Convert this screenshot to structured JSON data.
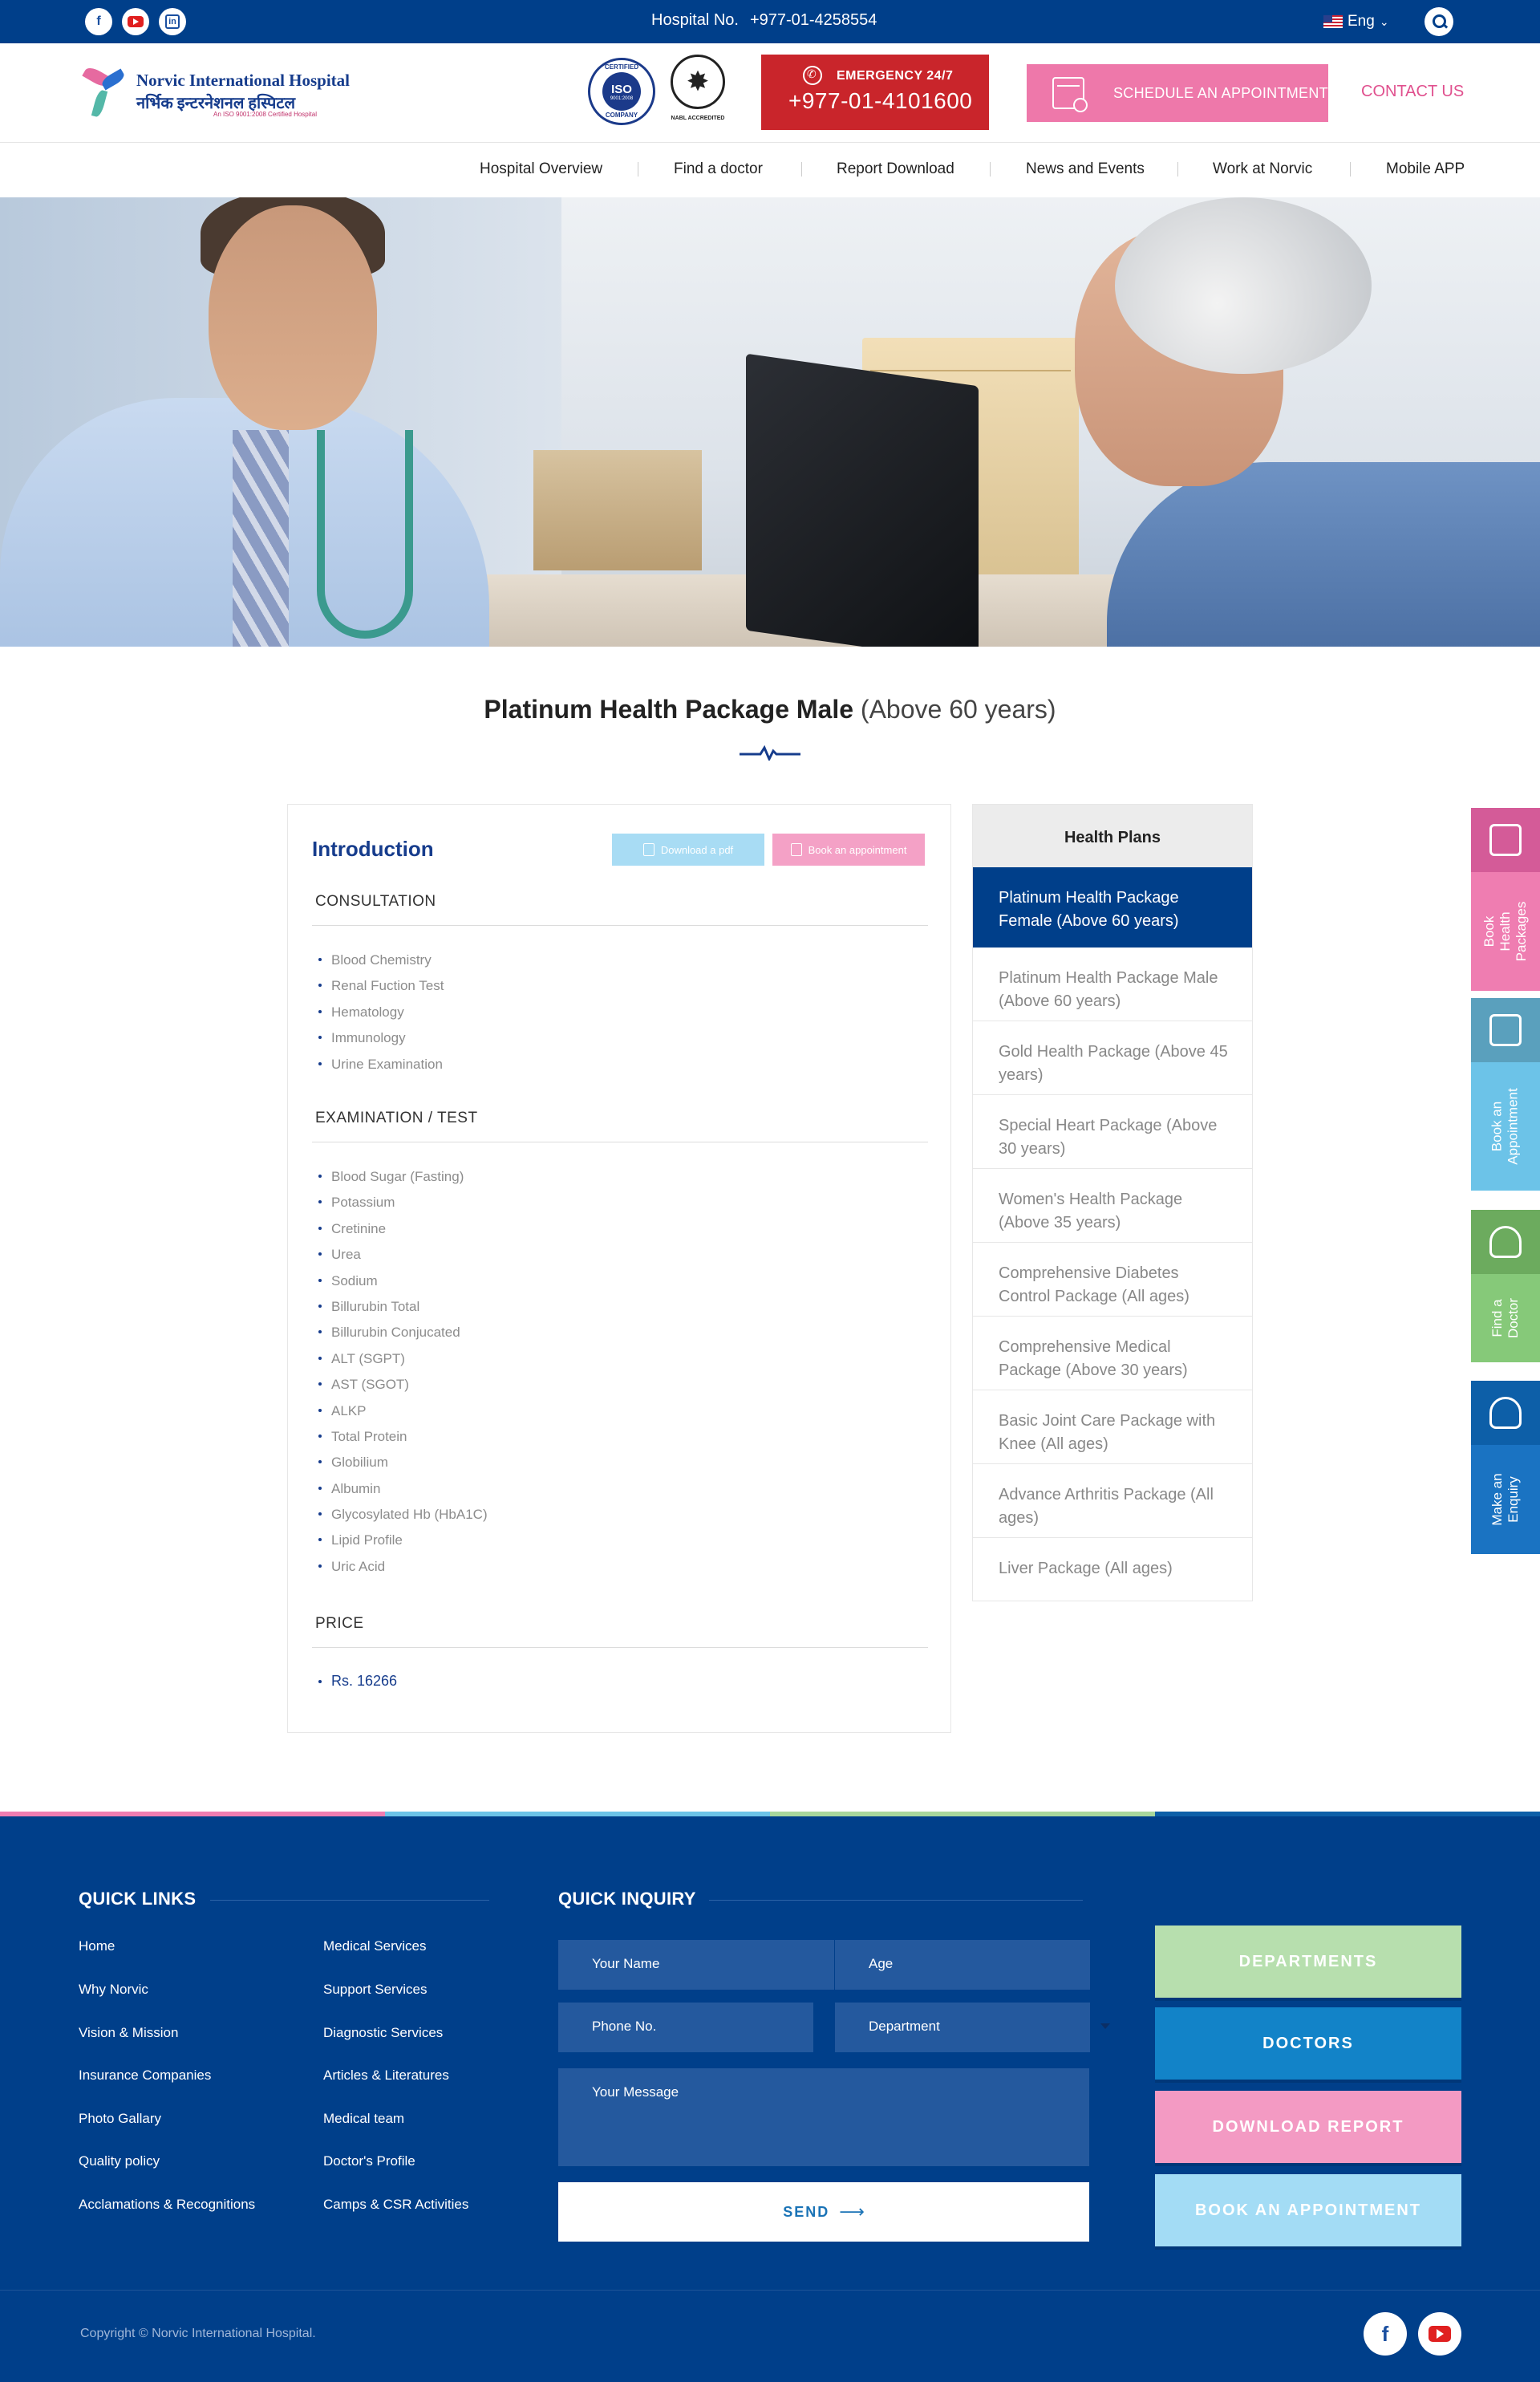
{
  "topbar": {
    "social": [
      {
        "name": "facebook-icon",
        "glyph": "f"
      },
      {
        "name": "youtube-icon",
        "glyph": ""
      },
      {
        "name": "linkedin-icon",
        "glyph": "in"
      }
    ],
    "hospital_label": "Hospital No.",
    "hospital_number": "+977-01-4258554",
    "language": "Eng"
  },
  "header": {
    "logo_name": "Norvic International Hospital",
    "logo_name_np": "नर्भिक इन्टरनेशनल हस्पिटल",
    "logo_cert": "An ISO 9001:2008 Certified Hospital",
    "iso_badge": {
      "top": "CERTIFIED",
      "main": "ISO",
      "sub": "9001:2008",
      "bottom": "COMPANY"
    },
    "nabl_label": "NABL ACCREDITED",
    "emergency_label": "EMERGENCY 24/7",
    "emergency_number": "+977-01-4101600",
    "schedule_label": "SCHEDULE AN APPOINTMENT",
    "contact_label": "CONTACT US"
  },
  "nav": [
    "Hospital Overview",
    "Find a doctor",
    "Report Download",
    "News and Events",
    "Work at Norvic",
    "Mobile APP"
  ],
  "page": {
    "title_bold": "Platinum Health Package Male",
    "title_light": "(Above 60 years)"
  },
  "card": {
    "title": "Introduction",
    "pdf_label": "Download a pdf",
    "book_label": "Book an appointment",
    "consultation": {
      "title": "CONSULTATION",
      "items": [
        "Blood Chemistry",
        "Renal Fuction Test",
        "Hematology",
        "Immunology",
        "Urine Examination"
      ]
    },
    "examination": {
      "title": "EXAMINATION / TEST",
      "items": [
        "Blood Sugar (Fasting)",
        "Potassium",
        "Cretinine",
        "Urea",
        "Sodium",
        "Billurubin Total",
        "Billurubin Conjucated",
        "ALT (SGPT)",
        "AST (SGOT)",
        "ALKP",
        "Total Protein",
        "Globilium",
        "Albumin",
        "Glycosylated Hb (HbA1C)",
        "Lipid Profile",
        "Uric Acid"
      ]
    },
    "price": {
      "title": "PRICE",
      "value": "Rs. 16266"
    }
  },
  "plans": {
    "title": "Health Plans",
    "items": [
      {
        "label": "Platinum Health Package Female (Above 60 years)",
        "active": true
      },
      {
        "label": "Platinum Health Package Male (Above 60 years)",
        "active": false
      },
      {
        "label": "Gold Health Package (Above 45 years)",
        "active": false
      },
      {
        "label": "Special Heart Package (Above 30 years)",
        "active": false
      },
      {
        "label": "Women's Health Package (Above 35 years)",
        "active": false
      },
      {
        "label": "Comprehensive Diabetes Control Package (All ages)",
        "active": false
      },
      {
        "label": "Comprehensive Medical Package (Above 30 years)",
        "active": false
      },
      {
        "label": "Basic Joint Care Package with Knee (All ages)",
        "active": false
      },
      {
        "label": "Advance Arthritis Package (All ages)",
        "active": false
      },
      {
        "label": "Liver Package (All ages)",
        "active": false
      }
    ]
  },
  "side_tabs": [
    {
      "label": "Book Health Packages",
      "icon": "health-package-icon",
      "top_color": "#d45b98",
      "bottom_color": "#ef7db1"
    },
    {
      "label": "Book an Appointment",
      "icon": "calendar-icon",
      "top_color": "#5aa0bd",
      "bottom_color": "#6cc3e8"
    },
    {
      "label": "Find a Doctor",
      "icon": "doctor-icon",
      "top_color": "#6cab5e",
      "bottom_color": "#86c979"
    },
    {
      "label": "Make an Enquiry",
      "icon": "enquiry-icon",
      "top_color": "#0d5fa8",
      "bottom_color": "#1a73c2"
    }
  ],
  "footer": {
    "strip_colors": [
      "#ef7db1",
      "#6cc3e8",
      "#a8d79c",
      "#0d5fa8"
    ],
    "quick_links_title": "QUICK LINKS",
    "quick_links_col1": [
      "Home",
      "Why Norvic",
      "Vision & Mission",
      "Insurance Companies",
      "Photo Gallary",
      "Quality policy",
      "Acclamations & Recognitions"
    ],
    "quick_links_col2": [
      "Medical Services",
      "Support Services",
      "Diagnostic Services",
      "Articles & Literatures",
      "Medical team",
      "Doctor's Profile",
      "Camps & CSR Activities"
    ],
    "inquiry_title": "QUICK INQUIRY",
    "fields": {
      "name": "Your Name",
      "age": "Age",
      "phone": "Phone No.",
      "department": "Department",
      "message": "Your Message"
    },
    "send_label": "SEND",
    "buttons": [
      {
        "label": "DEPARTMENTS",
        "color": "#b7dfae"
      },
      {
        "label": "DOCTORS",
        "color": "#1283c8"
      },
      {
        "label": "DOWNLOAD REPORT",
        "color": "#f39ac3"
      },
      {
        "label": "BOOK AN APPOINTMENT",
        "color": "#a3dcf5"
      }
    ],
    "copyright": "Copyright © Norvic International Hospital."
  }
}
